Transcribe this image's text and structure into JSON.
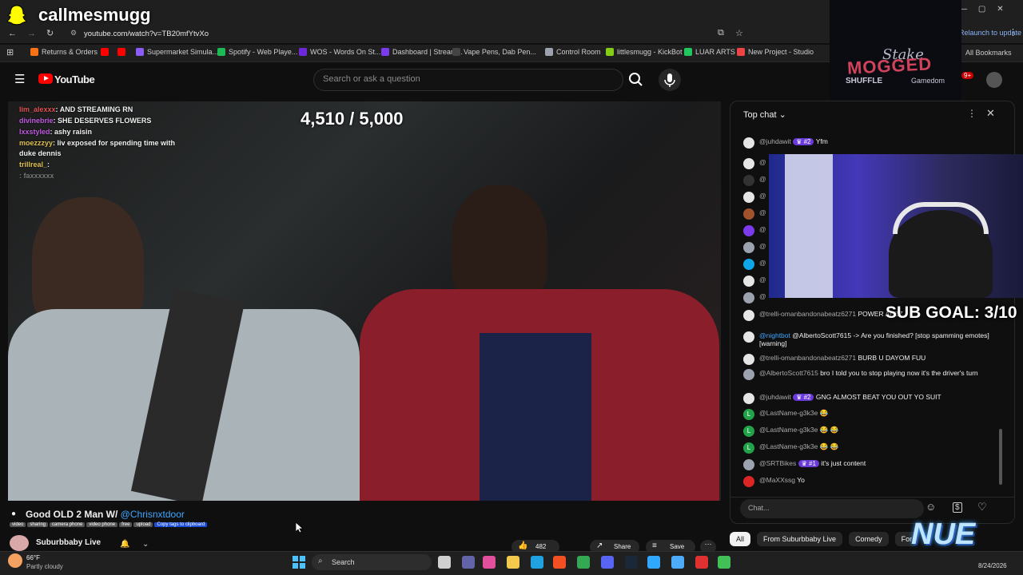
{
  "overlay": {
    "streamer_name": "callmesmugg",
    "goal_counter": "4,510 / 5,000",
    "sub_goal": "SUB GOAL: 3/10",
    "stake_text": "Stake",
    "mogged_text": "MOGGED",
    "shuffle_text": "SHUFFLE",
    "gamedom_text": "Gamedom",
    "nue_logo": "NUE"
  },
  "browser": {
    "url": "youtube.com/watch?v=TB20mfYtvXo",
    "relaunch": "Relaunch to update",
    "all_bookmarks": "All Bookmarks",
    "bookmarks": [
      {
        "label": "Returns & Orders",
        "color": "#f97316"
      },
      {
        "label": "",
        "color": "#ff0000"
      },
      {
        "label": "",
        "color": "#ff0000"
      },
      {
        "label": "Supermarket Simula...",
        "color": "#8b5cf6"
      },
      {
        "label": "Spotify - Web Playe...",
        "color": "#1db954"
      },
      {
        "label": "WOS - Words On St...",
        "color": "#6d28d9"
      },
      {
        "label": "Dashboard | Stream...",
        "color": "#7c3aed"
      },
      {
        "label": "Vape Pens, Dab Pen...",
        "color": "#444444"
      },
      {
        "label": "Control Room",
        "color": "#9ca3af"
      },
      {
        "label": "littlesmugg - KickBot",
        "color": "#84cc16"
      },
      {
        "label": "LUAR ARTS",
        "color": "#22c55e"
      },
      {
        "label": "New Project - Studio",
        "color": "#ef4444"
      }
    ]
  },
  "youtube": {
    "logo": "YouTube",
    "search_placeholder": "Search or ask a question",
    "notif_count": "9+"
  },
  "stream_chat_overlay": [
    {
      "user": "lim_alexxx",
      "text": ": AND STREAMING RN"
    },
    {
      "user": "divinebrie",
      "text": ": SHE DESERVES FLOWERS"
    },
    {
      "user": "lxxstyled",
      "text": ": ashy raisin"
    },
    {
      "user": "moezzzyy",
      "text": ": liv exposed for spending time with duke dennis"
    },
    {
      "user": "trillreal_",
      "text": ":"
    },
    {
      "user": "",
      "text": ": faxxxxxx"
    }
  ],
  "video": {
    "title_prefix": "Good OLD 2 Man W/ ",
    "title_link": "@Chrisnxtdoor",
    "tags": [
      "video",
      "sharing",
      "camera phone",
      "video phone",
      "free",
      "upload"
    ],
    "copy_tags": "Copy tags to clipboard",
    "channel": "Suburbbaby Live",
    "likes": "482",
    "share": "Share",
    "save": "Save"
  },
  "chat": {
    "header": "Top chat",
    "input_placeholder": "Chat...",
    "messages": [
      {
        "author": "@juhdawit",
        "badge": "#2",
        "text": "Yfm",
        "avatar_color": "#e5e5e5",
        "avatar_letter": ""
      },
      {
        "author": "@trelli-omanbandonabeatz6271",
        "badge": "",
        "text": "POWER AHZZ",
        "avatar_color": "#e5e5e5",
        "avatar_letter": ""
      },
      {
        "author": "@nightbot",
        "badge": "",
        "text": "@AlbertoScott7615 -> Are you finished? [stop spamming emotes] [warning]",
        "avatar_color": "#e5e5e5",
        "avatar_letter": "",
        "blue": true
      },
      {
        "author": "@trelli-omanbandonabeatz6271",
        "badge": "",
        "text": "BURB U DAYOM FUU",
        "avatar_color": "#e5e5e5",
        "avatar_letter": ""
      },
      {
        "author": "@AlbertoScott7615",
        "badge": "",
        "text": "bro I told you to stop playing now it's the driver's turn",
        "avatar_color": "#9ca3af",
        "avatar_letter": ""
      },
      {
        "author": "@juhdawit",
        "badge": "#2",
        "text": "GNG ALMOST BEAT YOU OUT YO SUIT",
        "avatar_color": "#e5e5e5",
        "avatar_letter": ""
      },
      {
        "author": "@LastName-g3k3e",
        "badge": "",
        "text": "😂",
        "avatar_color": "#22a34a",
        "avatar_letter": "L"
      },
      {
        "author": "@LastName-g3k3e",
        "badge": "",
        "text": "😂 😂",
        "avatar_color": "#22a34a",
        "avatar_letter": "L"
      },
      {
        "author": "@LastName-g3k3e",
        "badge": "",
        "text": "😂 😂",
        "avatar_color": "#22a34a",
        "avatar_letter": "L"
      },
      {
        "author": "@SRTBikes",
        "badge": "#1",
        "text": "it's just content",
        "avatar_color": "#9ca3af",
        "avatar_letter": ""
      },
      {
        "author": "@MaXXssg",
        "badge": "",
        "text": "Yo",
        "avatar_color": "#dc2626",
        "avatar_letter": ""
      }
    ],
    "partial_authors": [
      "@",
      "@",
      "@",
      "@",
      "@",
      "@",
      "@",
      "@",
      "@",
      "@"
    ]
  },
  "chips": [
    "All",
    "From Suburbbaby Live",
    "Comedy",
    "For"
  ],
  "taskbar": {
    "weather_temp": "66°F",
    "weather_desc": "Partly cloudy",
    "search": "Search",
    "date": "8/24/2026"
  }
}
